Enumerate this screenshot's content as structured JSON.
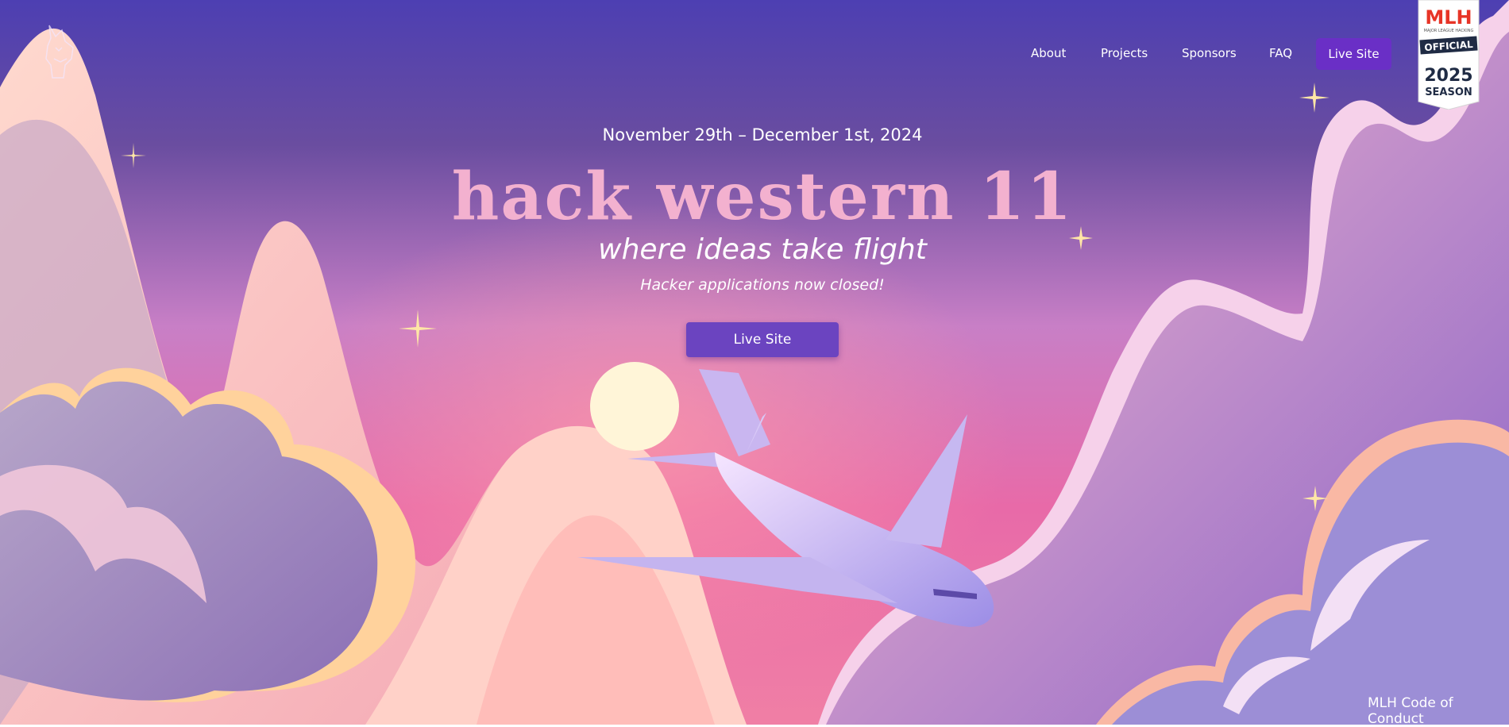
{
  "nav": {
    "links": [
      {
        "label": "About"
      },
      {
        "label": "Projects"
      },
      {
        "label": "Sponsors"
      },
      {
        "label": "FAQ"
      }
    ],
    "cta_label": "Live Site"
  },
  "badge": {
    "brand": "MLH",
    "subtitle": "MAJOR LEAGUE HACKING",
    "official": "OFFICIAL",
    "year": "2025",
    "season": "SEASON"
  },
  "hero": {
    "date": "November 29th – December 1st, 2024",
    "title": "hack western 11",
    "tagline": "where ideas take flight",
    "status": "Hacker applications now closed!",
    "cta_label": "Live Site"
  },
  "footer": {
    "coc_label": "MLH Code of Conduct"
  },
  "icons": [
    "horse-logo-icon",
    "sparkle-icon",
    "sun-icon",
    "airplane-icon",
    "cloud-icon",
    "mountain-icon"
  ],
  "colors": {
    "accent": "#6a2fc6",
    "title_pink": "#f3b1cf",
    "sky_top": "#4f3fb0",
    "sky_mid": "#d57ac9",
    "horizon_pink": "#f2608f"
  }
}
